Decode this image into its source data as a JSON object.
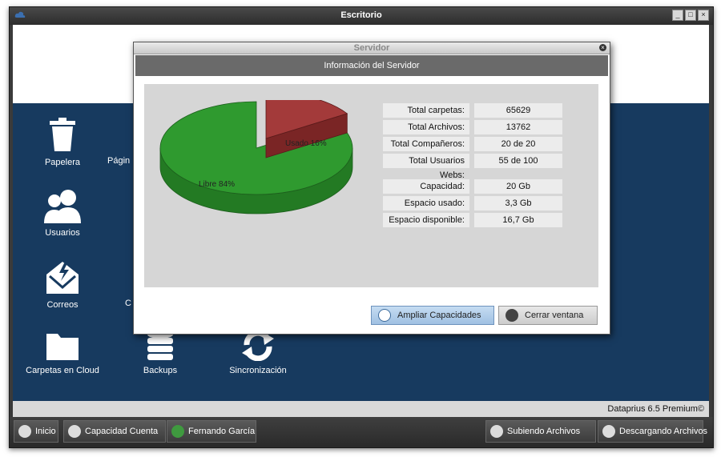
{
  "window": {
    "title": "Escritorio"
  },
  "desktop_icons": [
    {
      "label": "Papelera",
      "icon": "trash-icon"
    },
    {
      "label": "Págin",
      "icon": "pages-icon"
    },
    {
      "label": "Usuarios",
      "icon": "users-icon"
    },
    {
      "label": "Correos",
      "icon": "mail-icon"
    },
    {
      "label": "C",
      "icon": "unknown-icon"
    },
    {
      "label": "Carpetas en Cloud",
      "icon": "folder-icon"
    },
    {
      "label": "Backups",
      "icon": "database-icon"
    },
    {
      "label": "Sincronización",
      "icon": "sync-icon"
    }
  ],
  "brand": "Dataprius 6.5 Premium©",
  "taskbar": {
    "inicio": "Inicio",
    "capacidad": "Capacidad Cuenta",
    "user": "Fernando García",
    "subiendo": "Subiendo Archivos",
    "descargando": "Descargando Archivos"
  },
  "modal": {
    "title": "Servidor",
    "header": "Información del Servidor",
    "stats": [
      {
        "label": "Total carpetas:",
        "value": "65629"
      },
      {
        "label": "Total Archivos:",
        "value": "13762"
      },
      {
        "label": "Total Compañeros:",
        "value": "20 de 20"
      },
      {
        "label": "Total Usuarios Webs:",
        "value": "55 de 100"
      }
    ],
    "storage": [
      {
        "label": "Capacidad:",
        "value": "20 Gb"
      },
      {
        "label": "Espacio usado:",
        "value": "3,3 Gb"
      },
      {
        "label": "Espacio disponible:",
        "value": "16,7 Gb"
      }
    ],
    "ampliar_label": "Ampliar Capacidades",
    "cerrar_label": "Cerrar ventana"
  },
  "chart_data": {
    "type": "pie",
    "categories": [
      "Usado",
      "Libre"
    ],
    "values": [
      16,
      84
    ],
    "labels": [
      "Usado 16%",
      "Libre 84%"
    ],
    "colors": [
      "#a33a3a",
      "#2f9a2f"
    ]
  },
  "colors": {
    "desktop_blue": "#173a5f",
    "accent_button": "#a9c8e8"
  }
}
